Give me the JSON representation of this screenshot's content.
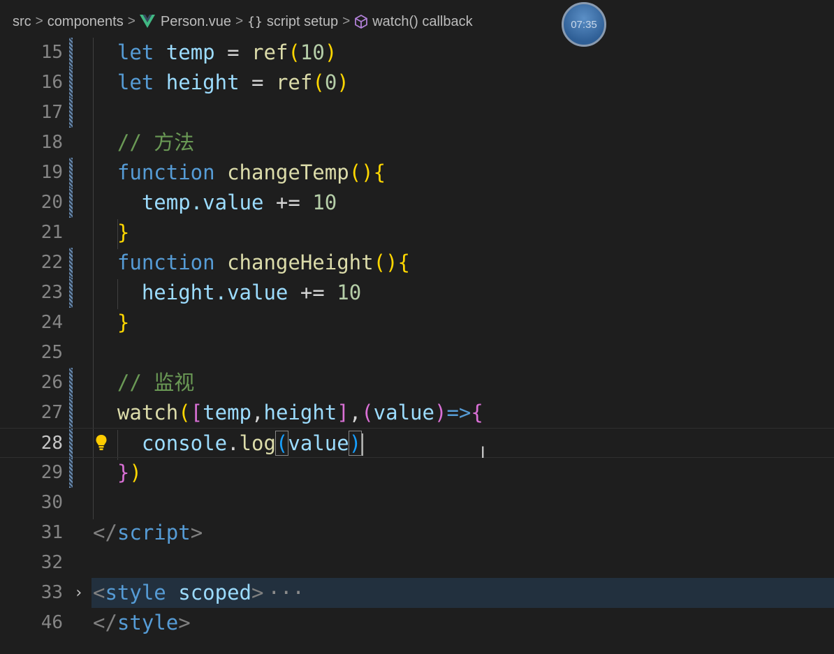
{
  "breadcrumb": {
    "items": [
      "src",
      "components",
      "Person.vue",
      "script setup",
      "watch() callback"
    ],
    "separator": ">",
    "braces": "{}"
  },
  "timer": {
    "text": "07:35"
  },
  "editor": {
    "active_line": "28",
    "lines": [
      {
        "num": "15",
        "parts": [
          "let",
          "temp",
          "=",
          "ref",
          "(",
          "10",
          ")"
        ]
      },
      {
        "num": "16",
        "parts": [
          "let",
          "height",
          "=",
          "ref",
          "(",
          "0",
          ")"
        ]
      },
      {
        "num": "17"
      },
      {
        "num": "18",
        "parts": [
          "// 方法"
        ]
      },
      {
        "num": "19",
        "parts": [
          "function",
          "changeTemp",
          "()",
          "{"
        ]
      },
      {
        "num": "20",
        "parts": [
          "temp",
          ".value",
          "+=",
          "10"
        ]
      },
      {
        "num": "21",
        "parts": [
          "}"
        ]
      },
      {
        "num": "22",
        "parts": [
          "function",
          "changeHeight",
          "()",
          "{"
        ]
      },
      {
        "num": "23",
        "parts": [
          "height",
          ".value",
          "+=",
          "10"
        ]
      },
      {
        "num": "24",
        "parts": [
          "}"
        ]
      },
      {
        "num": "25"
      },
      {
        "num": "26",
        "parts": [
          "// 监视"
        ]
      },
      {
        "num": "27",
        "parts": [
          "watch",
          "(",
          "[",
          "temp",
          ",",
          "height",
          "]",
          ",",
          "(",
          "value",
          ")",
          "=>",
          "{"
        ]
      },
      {
        "num": "28",
        "parts": [
          "console",
          ".",
          "log",
          "(",
          "value",
          ")"
        ]
      },
      {
        "num": "29",
        "parts": [
          "}",
          ")"
        ]
      },
      {
        "num": "30"
      },
      {
        "num": "31",
        "parts": [
          "</",
          "script",
          ">"
        ]
      },
      {
        "num": "32"
      },
      {
        "num": "33",
        "parts": [
          "<",
          "style",
          "scoped",
          ">",
          "···"
        ]
      },
      {
        "num": "46",
        "parts": [
          "</",
          "style",
          ">"
        ]
      }
    ]
  },
  "icons": {
    "vue": "vue-logo-icon",
    "cube": "symbol-method-icon",
    "bulb": "lightbulb-icon",
    "fold": "chevron-right-icon",
    "text_cursor": "i-beam-cursor-icon"
  },
  "colors": {
    "background": "#1e1e1e",
    "keyword": "#569cd6",
    "variable": "#9cdcfe",
    "function": "#dcdcaa",
    "number": "#b5cea8",
    "comment": "#6a9955",
    "bracket_gold": "#ffd700",
    "bracket_orchid": "#da70d6",
    "bracket_blue": "#179fff"
  }
}
